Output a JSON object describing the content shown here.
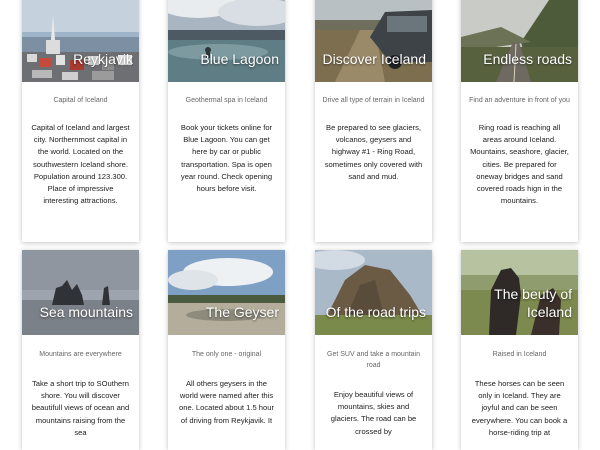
{
  "cards": [
    {
      "title": "Reykjavik",
      "subtitle": "Capital of Iceland",
      "description": "Capital of Iceland and largest city. Northernmost capital in the world. Located on the southwestern Iceland shore. Population around 123.300. Place of impressive interesting attractions."
    },
    {
      "title": "Blue Lagoon",
      "subtitle": "Geothermal spa in Iceland",
      "description": "Book your tickets online for Blue Lagoon. You can get here by car or public transportation. Spa is open year round. Check opening hours before visit."
    },
    {
      "title": "Discover Iceland",
      "subtitle": "Drive all type of terrain in Iceland",
      "description": "Be prepared to see glaciers, volcanos, geysers and highway #1 - Ring Road, sometimes only covered with sand and mud."
    },
    {
      "title": "Endless roads",
      "subtitle": "Find an adventure in front of you",
      "description": "Ring road is reaching all areas around Iceland. Mountains, seashore, glacier, cities. Be prepared for oneway bridges and sand covered roads hign in the mountains."
    },
    {
      "title": "Sea mountains",
      "subtitle": "Mountains are everywhere",
      "description": "Take a short trip to SOuthern shore. You will discover beautifull views of ocean and mountains raising from the sea"
    },
    {
      "title": "The Geyser",
      "subtitle": "The only one - original",
      "description": "All others geysers in the world were named after this one. Located about 1.5 hour of driving from Reykjavik. It"
    },
    {
      "title": "Of the road trips",
      "subtitle": "Get SUV and take a mountain road",
      "description": "Enjoy beautiful views of mountains, skies and glaciers. The road can be crossed by"
    },
    {
      "title": "The beuty of Iceland",
      "subtitle": "Raised in Iceland",
      "description": "These horses can be seen only in Iceland. They are joyful and can be seen everywhere. You can book a horse-riding trip at"
    }
  ]
}
